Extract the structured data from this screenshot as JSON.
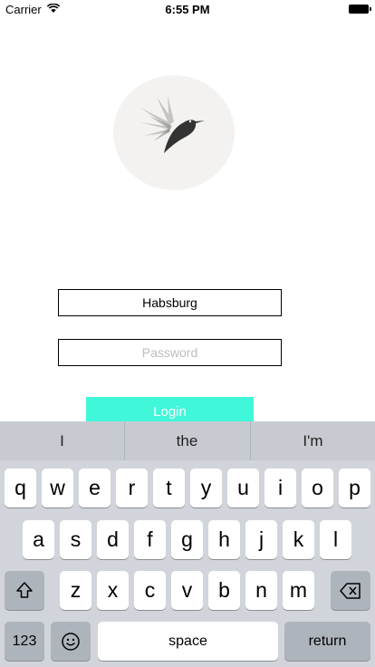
{
  "status_bar": {
    "carrier": "Carrier",
    "time": "6:55 PM"
  },
  "login": {
    "username_value": "Habsburg",
    "password_placeholder": "Password",
    "button_label": "Login"
  },
  "keyboard": {
    "suggestions": [
      "I",
      "the",
      "I'm"
    ],
    "row1": [
      "q",
      "w",
      "e",
      "r",
      "t",
      "y",
      "u",
      "i",
      "o",
      "p"
    ],
    "row2": [
      "a",
      "s",
      "d",
      "f",
      "g",
      "h",
      "j",
      "k",
      "l"
    ],
    "row3": [
      "z",
      "x",
      "c",
      "v",
      "b",
      "n",
      "m"
    ],
    "numbers_label": "123",
    "space_label": "space",
    "return_label": "return"
  },
  "icons": [
    "wifi-icon",
    "battery-icon",
    "hummingbird-logo-icon",
    "shift-icon",
    "delete-icon",
    "emoji-icon"
  ]
}
